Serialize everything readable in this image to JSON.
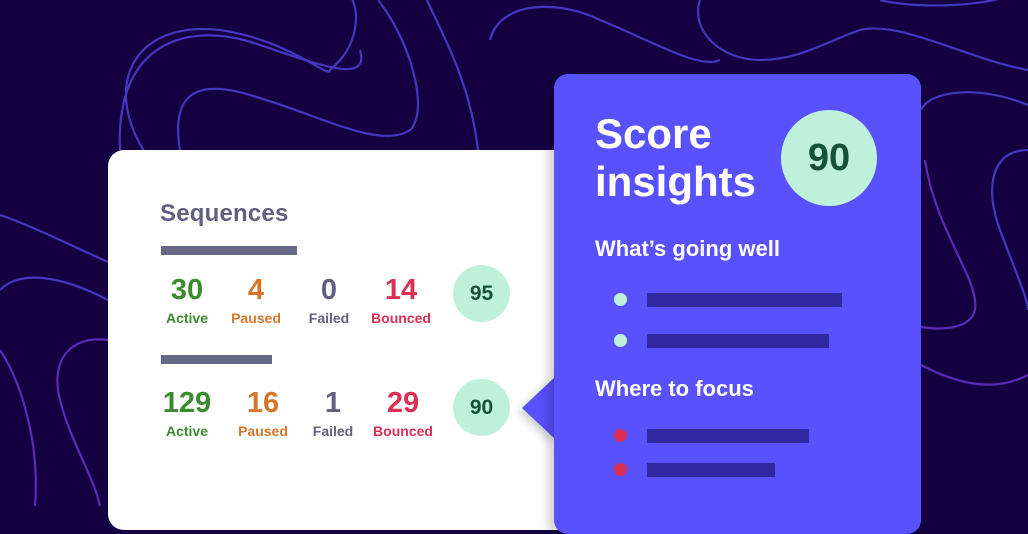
{
  "background": {
    "color": "#140041",
    "wave_color": "#4b3bc8"
  },
  "sequences_card": {
    "title": "Sequences",
    "rows": [
      {
        "stats": [
          {
            "value": "30",
            "label": "Active"
          },
          {
            "value": "4",
            "label": "Paused"
          },
          {
            "value": "0",
            "label": "Failed"
          },
          {
            "value": "14",
            "label": "Bounced"
          }
        ],
        "score": "95"
      },
      {
        "stats": [
          {
            "value": "129",
            "label": "Active"
          },
          {
            "value": "16",
            "label": "Paused"
          },
          {
            "value": "1",
            "label": "Failed"
          },
          {
            "value": "29",
            "label": "Bounced"
          }
        ],
        "score": "90"
      }
    ],
    "colors": {
      "active": "#3b8c2f",
      "paused": "#d87529",
      "failed": "#625f80",
      "bounced": "#db2f54"
    }
  },
  "insights_panel": {
    "title": "Score insights",
    "score": "90",
    "going_well": {
      "heading": "What’s going well",
      "items": 2
    },
    "focus": {
      "heading": "Where to focus",
      "items": 2
    },
    "colors": {
      "panel": "#5951fd",
      "score_bg": "#bff0dc",
      "good_bullet": "#bff0dc",
      "bad_bullet": "#db2f54"
    }
  }
}
